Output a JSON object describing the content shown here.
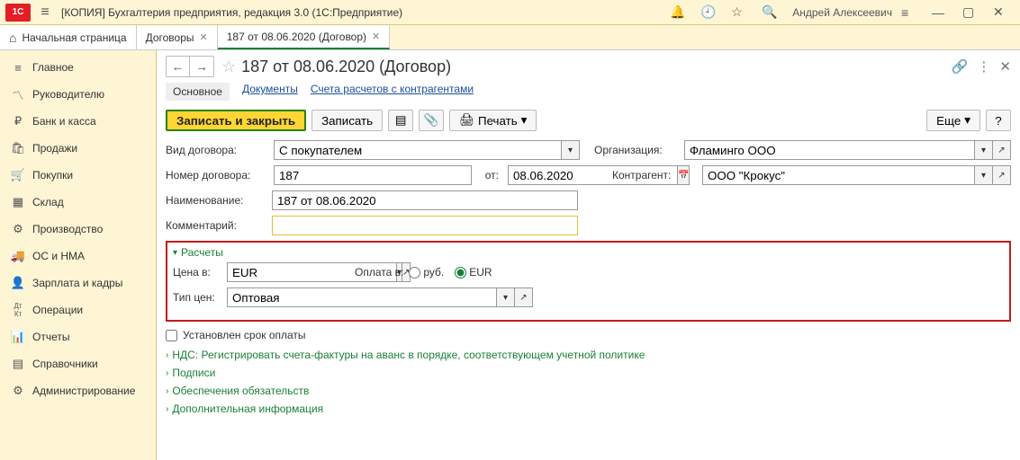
{
  "titlebar": {
    "app_title": "[КОПИЯ] Бухгалтерия предприятия, редакция 3.0  (1С:Предприятие)",
    "user": "Андрей Алексеевич",
    "logo": "1C"
  },
  "tabs": {
    "home": "Начальная страница",
    "items": [
      {
        "label": "Договоры"
      },
      {
        "label": "187 от 08.06.2020 (Договор)"
      }
    ]
  },
  "sidebar": {
    "items": [
      {
        "label": "Главное",
        "icon": "≡"
      },
      {
        "label": "Руководителю",
        "icon": "📈"
      },
      {
        "label": "Банк и касса",
        "icon": "₽"
      },
      {
        "label": "Продажи",
        "icon": "🛍"
      },
      {
        "label": "Покупки",
        "icon": "🛒"
      },
      {
        "label": "Склад",
        "icon": "🏢"
      },
      {
        "label": "Производство",
        "icon": "🏭"
      },
      {
        "label": "ОС и НМА",
        "icon": "🚚"
      },
      {
        "label": "Зарплата и кадры",
        "icon": "👤"
      },
      {
        "label": "Операции",
        "icon": "Дт/Кт"
      },
      {
        "label": "Отчеты",
        "icon": "📊"
      },
      {
        "label": "Справочники",
        "icon": "📚"
      },
      {
        "label": "Администрирование",
        "icon": "⚙"
      }
    ]
  },
  "page": {
    "title": "187 от 08.06.2020 (Договор)"
  },
  "subnav": {
    "main": "Основное",
    "documents": "Документы",
    "accounts": "Счета расчетов с контрагентами"
  },
  "toolbar": {
    "save_close": "Записать и закрыть",
    "save": "Записать",
    "print": "Печать",
    "more": "Еще"
  },
  "form": {
    "contract_type_label": "Вид договора:",
    "contract_type_value": "С покупателем",
    "org_label": "Организация:",
    "org_value": "Фламинго ООО",
    "number_label": "Номер договора:",
    "number_value": "187",
    "date_label": "от:",
    "date_value": "08.06.2020",
    "counterparty_label": "Контрагент:",
    "counterparty_value": "ООО \"Крокус\"",
    "name_label": "Наименование:",
    "name_value": "187 от 08.06.2020",
    "comment_label": "Комментарий:",
    "comment_value": ""
  },
  "calc": {
    "section_title": "Расчеты",
    "price_in_label": "Цена в:",
    "price_in_value": "EUR",
    "pay_in_label": "Оплата в:",
    "pay_rub": "руб.",
    "pay_eur": "EUR",
    "price_type_label": "Тип цен:",
    "price_type_value": "Оптовая"
  },
  "bottom": {
    "due_set": "Установлен срок оплаты",
    "nds": "НДС: Регистрировать счета-фактуры на аванс в порядке, соответствующем учетной политике",
    "signatures": "Подписи",
    "obligations": "Обеспечения обязательств",
    "addinfo": "Дополнительная информация"
  }
}
